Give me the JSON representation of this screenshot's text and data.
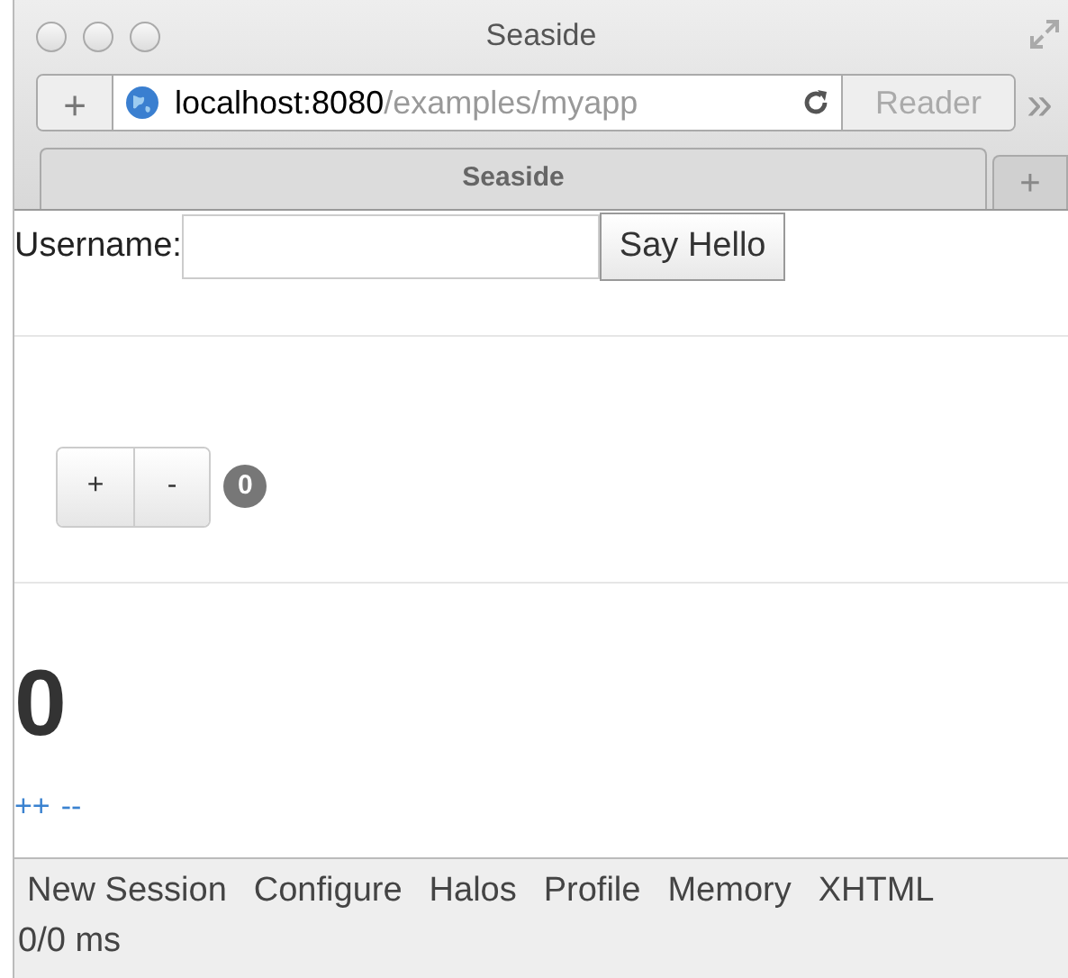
{
  "window": {
    "title": "Seaside"
  },
  "toolbar": {
    "url_host": "localhost:8080",
    "url_path": "/examples/myapp",
    "reader": "Reader",
    "new_tab": "+",
    "overflow": "»"
  },
  "tabs": [
    {
      "label": "Seaside",
      "selected": true
    }
  ],
  "add_tab": "+",
  "form": {
    "label": "Username:",
    "button": "Say Hello"
  },
  "counter_widget": {
    "buttons": [
      "+",
      "-"
    ],
    "badge": "0"
  },
  "counter": {
    "value": "0",
    "links": [
      "++",
      "--"
    ]
  },
  "dev_toolbar": {
    "links": [
      "New Session",
      "Configure",
      "Halos",
      "Profile",
      "Memory",
      "XHTML"
    ],
    "timing": "0/0 ms"
  }
}
